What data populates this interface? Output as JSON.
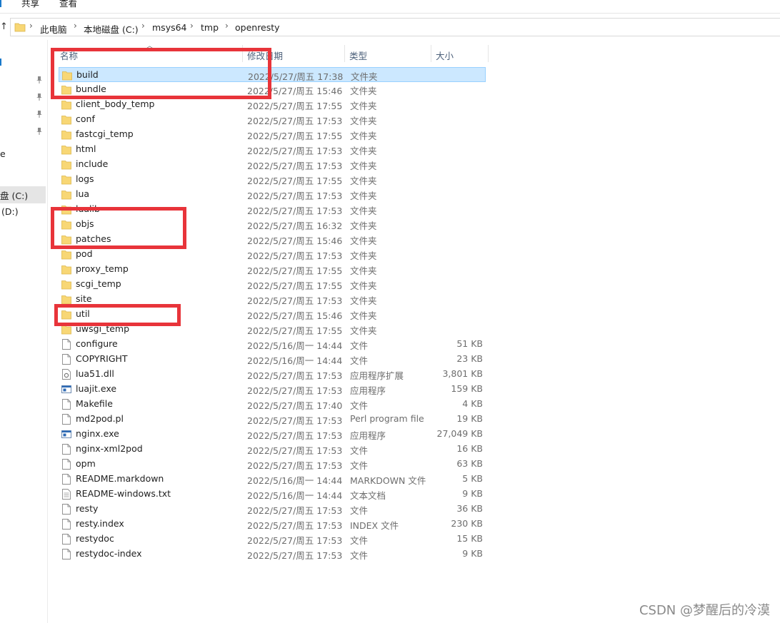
{
  "ribbon": {
    "tabs": [
      "共享",
      "查看"
    ]
  },
  "address": {
    "up_icon": "up-arrow-icon",
    "crumbs": [
      "此电脑",
      "本地磁盘 (C:)",
      "msys64",
      "tmp",
      "openresty"
    ]
  },
  "nav": {
    "pane_text_1": "e",
    "drive_c": "盘 (C:)",
    "drive_d": "(D:)"
  },
  "columns": {
    "name": "名称",
    "modified": "修改日期",
    "type": "类型",
    "size": "大小"
  },
  "files": [
    {
      "name": "build",
      "date": "2022/5/27/周五 17:38",
      "type": "文件夹",
      "size": "",
      "icon": "folder-icon"
    },
    {
      "name": "bundle",
      "date": "2022/5/27/周五 15:46",
      "type": "文件夹",
      "size": "",
      "icon": "folder-icon"
    },
    {
      "name": "client_body_temp",
      "date": "2022/5/27/周五 17:55",
      "type": "文件夹",
      "size": "",
      "icon": "folder-icon"
    },
    {
      "name": "conf",
      "date": "2022/5/27/周五 17:53",
      "type": "文件夹",
      "size": "",
      "icon": "folder-icon"
    },
    {
      "name": "fastcgi_temp",
      "date": "2022/5/27/周五 17:55",
      "type": "文件夹",
      "size": "",
      "icon": "folder-icon"
    },
    {
      "name": "html",
      "date": "2022/5/27/周五 17:53",
      "type": "文件夹",
      "size": "",
      "icon": "folder-icon"
    },
    {
      "name": "include",
      "date": "2022/5/27/周五 17:53",
      "type": "文件夹",
      "size": "",
      "icon": "folder-icon"
    },
    {
      "name": "logs",
      "date": "2022/5/27/周五 17:55",
      "type": "文件夹",
      "size": "",
      "icon": "folder-icon"
    },
    {
      "name": "lua",
      "date": "2022/5/27/周五 17:53",
      "type": "文件夹",
      "size": "",
      "icon": "folder-icon"
    },
    {
      "name": "lualib",
      "date": "2022/5/27/周五 17:53",
      "type": "文件夹",
      "size": "",
      "icon": "folder-icon"
    },
    {
      "name": "objs",
      "date": "2022/5/27/周五 16:32",
      "type": "文件夹",
      "size": "",
      "icon": "folder-icon"
    },
    {
      "name": "patches",
      "date": "2022/5/27/周五 15:46",
      "type": "文件夹",
      "size": "",
      "icon": "folder-icon"
    },
    {
      "name": "pod",
      "date": "2022/5/27/周五 17:53",
      "type": "文件夹",
      "size": "",
      "icon": "folder-icon"
    },
    {
      "name": "proxy_temp",
      "date": "2022/5/27/周五 17:55",
      "type": "文件夹",
      "size": "",
      "icon": "folder-icon"
    },
    {
      "name": "scgi_temp",
      "date": "2022/5/27/周五 17:55",
      "type": "文件夹",
      "size": "",
      "icon": "folder-icon"
    },
    {
      "name": "site",
      "date": "2022/5/27/周五 17:53",
      "type": "文件夹",
      "size": "",
      "icon": "folder-icon"
    },
    {
      "name": "util",
      "date": "2022/5/27/周五 15:46",
      "type": "文件夹",
      "size": "",
      "icon": "folder-icon"
    },
    {
      "name": "uwsgi_temp",
      "date": "2022/5/27/周五 17:55",
      "type": "文件夹",
      "size": "",
      "icon": "folder-icon"
    },
    {
      "name": "configure",
      "date": "2022/5/16/周一 14:44",
      "type": "文件",
      "size": "51 KB",
      "icon": "file-icon"
    },
    {
      "name": "COPYRIGHT",
      "date": "2022/5/16/周一 14:44",
      "type": "文件",
      "size": "23 KB",
      "icon": "file-icon"
    },
    {
      "name": "lua51.dll",
      "date": "2022/5/27/周五 17:53",
      "type": "应用程序扩展",
      "size": "3,801 KB",
      "icon": "dll-icon"
    },
    {
      "name": "luajit.exe",
      "date": "2022/5/27/周五 17:53",
      "type": "应用程序",
      "size": "159 KB",
      "icon": "exe-icon"
    },
    {
      "name": "Makefile",
      "date": "2022/5/27/周五 17:40",
      "type": "文件",
      "size": "4 KB",
      "icon": "file-icon"
    },
    {
      "name": "md2pod.pl",
      "date": "2022/5/27/周五 17:53",
      "type": "Perl program file",
      "size": "19 KB",
      "icon": "file-icon"
    },
    {
      "name": "nginx.exe",
      "date": "2022/5/27/周五 17:53",
      "type": "应用程序",
      "size": "27,049 KB",
      "icon": "exe-icon"
    },
    {
      "name": "nginx-xml2pod",
      "date": "2022/5/27/周五 17:53",
      "type": "文件",
      "size": "16 KB",
      "icon": "file-icon"
    },
    {
      "name": "opm",
      "date": "2022/5/27/周五 17:53",
      "type": "文件",
      "size": "63 KB",
      "icon": "file-icon"
    },
    {
      "name": "README.markdown",
      "date": "2022/5/16/周一 14:44",
      "type": "MARKDOWN 文件",
      "size": "5 KB",
      "icon": "file-icon"
    },
    {
      "name": "README-windows.txt",
      "date": "2022/5/16/周一 14:44",
      "type": "文本文档",
      "size": "9 KB",
      "icon": "text-file-icon"
    },
    {
      "name": "resty",
      "date": "2022/5/27/周五 17:53",
      "type": "文件",
      "size": "36 KB",
      "icon": "file-icon"
    },
    {
      "name": "resty.index",
      "date": "2022/5/27/周五 17:53",
      "type": "INDEX 文件",
      "size": "230 KB",
      "icon": "file-icon"
    },
    {
      "name": "restydoc",
      "date": "2022/5/27/周五 17:53",
      "type": "文件",
      "size": "15 KB",
      "icon": "file-icon"
    },
    {
      "name": "restydoc-index",
      "date": "2022/5/27/周五 17:53",
      "type": "文件",
      "size": "9 KB",
      "icon": "file-icon"
    }
  ],
  "selected_index": 0,
  "colors": {
    "selection": "#cce8ff",
    "highlight": "#e8343a",
    "folder": "#f8d775"
  },
  "watermark": "CSDN @梦醒后的冷漠"
}
